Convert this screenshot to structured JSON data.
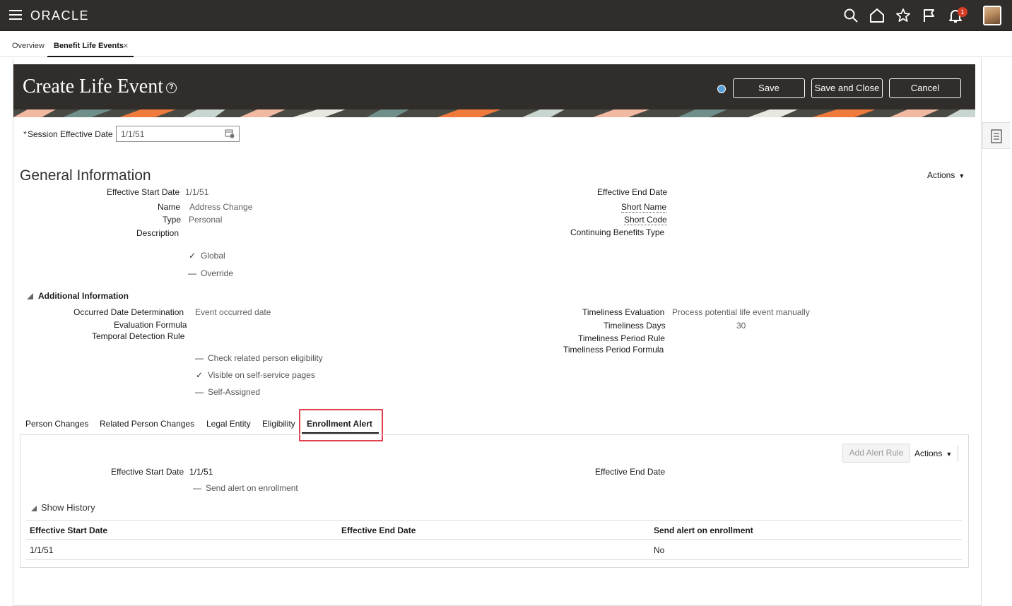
{
  "app": {
    "logo": "ORACLE",
    "notification_count": "1"
  },
  "tabs": [
    {
      "label": "Overview"
    },
    {
      "label": "Benefit Life Events",
      "close": "×"
    }
  ],
  "header": {
    "title": "Create Life Event",
    "help": "?",
    "save_label": "Save",
    "save_close_label": "Save and Close",
    "cancel_label": "Cancel"
  },
  "session": {
    "label_required": "*",
    "label": "Session Effective Date",
    "value": "1/1/51"
  },
  "general": {
    "title": "General Information",
    "actions_label": "Actions",
    "effective_start_label": "Effective Start Date",
    "effective_start_value": "1/1/51",
    "effective_end_label": "Effective End Date",
    "name_label": "Name",
    "name_value": "Address Change",
    "type_label": "Type",
    "type_value": "Personal",
    "description_label": "Description",
    "short_name_label": "Short Name",
    "short_code_label": "Short Code",
    "continuing_label": "Continuing Benefits Type",
    "global_label": "Global",
    "override_label": "Override"
  },
  "additional": {
    "title": "Additional Information",
    "occurred_label": "Occurred Date Determination",
    "occurred_value": "Event occurred date",
    "eval_formula_label": "Evaluation Formula",
    "temporal_label": "Temporal Detection Rule",
    "timeliness_eval_label": "Timeliness Evaluation",
    "timeliness_eval_value": "Process potential life event manually",
    "timeliness_days_label": "Timeliness Days",
    "timeliness_days_value": "30",
    "timeliness_rule_label": "Timeliness Period Rule",
    "timeliness_formula_label": "Timeliness Period Formula",
    "check_related_label": "Check related person eligibility",
    "visible_label": "Visible on self-service pages",
    "self_assigned_label": "Self-Assigned"
  },
  "lower_tabs": [
    {
      "label": "Person Changes"
    },
    {
      "label": "Related Person Changes"
    },
    {
      "label": "Legal Entity"
    },
    {
      "label": "Eligibility"
    },
    {
      "label": "Enrollment Alert"
    }
  ],
  "enrollment": {
    "add_rule_label": "Add Alert Rule",
    "actions_label": "Actions",
    "effective_start_label": "Effective Start Date",
    "effective_start_value": "1/1/51",
    "effective_end_label": "Effective End Date",
    "send_alert_label": "Send alert on enrollment",
    "show_history_label": "Show History",
    "columns": [
      "Effective Start Date",
      "Effective End Date",
      "Send alert on enrollment"
    ],
    "rows": [
      [
        "1/1/51",
        "",
        "No"
      ]
    ]
  },
  "colors": {
    "header_bg": "#312d2a",
    "highlight": "#e0414b",
    "badge": "#d63b25"
  }
}
